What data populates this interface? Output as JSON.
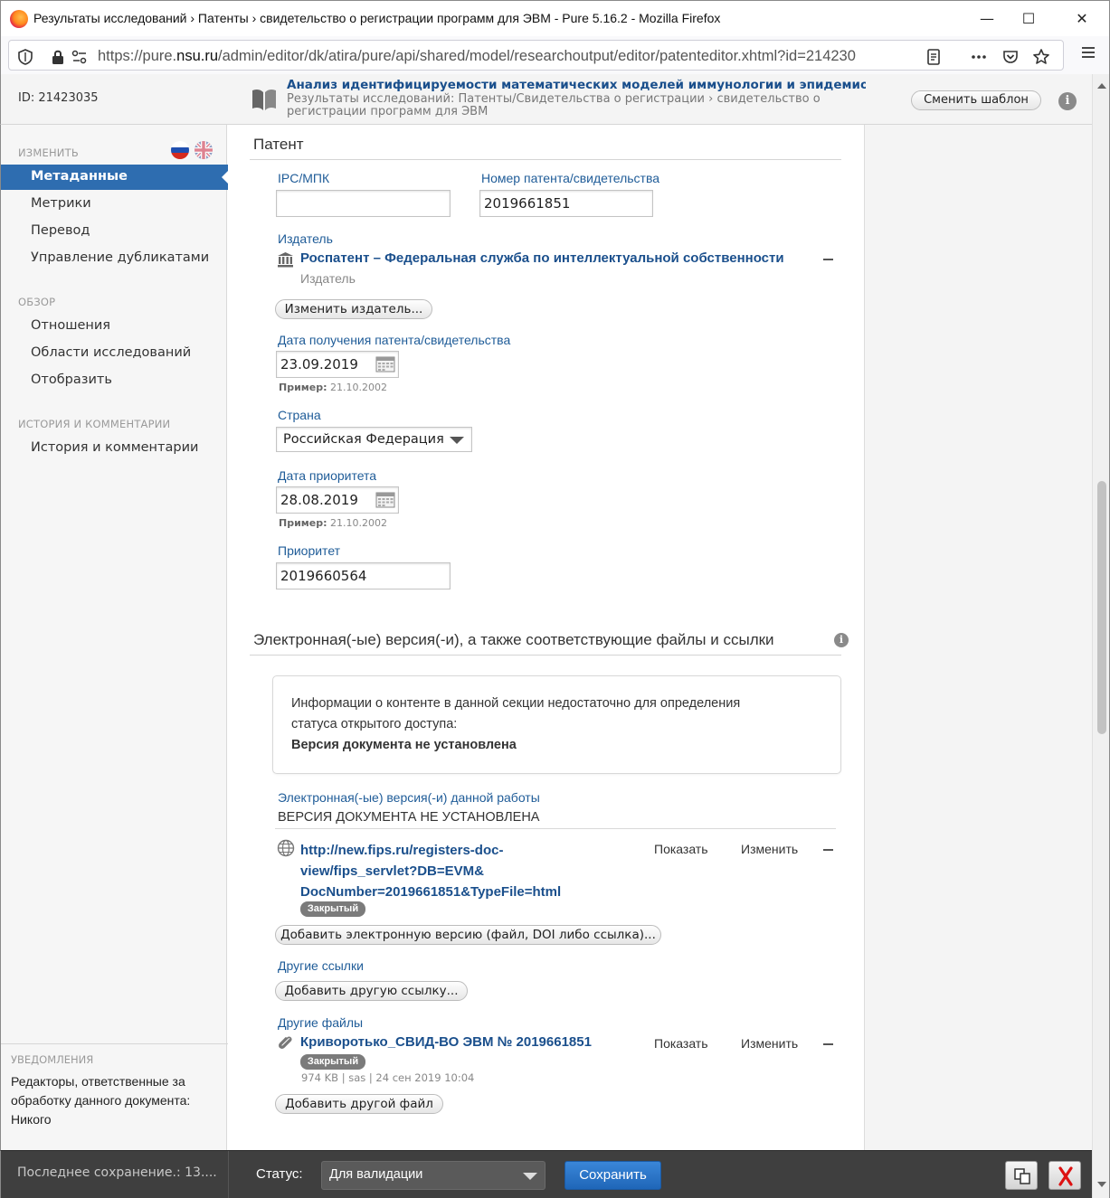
{
  "window": {
    "title": "Результаты исследований › Патенты › свидетельство о регистрации программ для ЭВМ - Pure 5.16.2 - Mozilla Firefox",
    "minimize": "—",
    "maximize": "☐",
    "close": "✕"
  },
  "urlbar": {
    "prefix": "https://pure.",
    "domain": "nsu.ru",
    "suffix": "/admin/editor/dk/atira/pure/api/shared/model/researchoutput/editor/patenteditor.xhtml?id=214230"
  },
  "header": {
    "id": "ID: 21423035",
    "title": "Анализ идентифицируемости математических моделей иммунологии и эпидемио",
    "breadcrumb": "Результаты исследований: Патенты/Свидетельства о регистрации › свидетельство о регистрации программ для ЭВМ",
    "change_template": "Сменить шаблон",
    "info": "i"
  },
  "sidebar": {
    "section_edit": "ИЗМЕНИТЬ",
    "edit_items": [
      "Метаданные",
      "Метрики",
      "Перевод",
      "Управление дубликатами"
    ],
    "section_overview": "ОБЗОР",
    "overview_items": [
      "Отношения",
      "Области исследований",
      "Отобразить"
    ],
    "section_history": "ИСТОРИЯ И КОММЕНТАРИИ",
    "history_items": [
      "История и комментарии"
    ],
    "notifications_title": "УВЕДОМЛЕНИЯ",
    "notifications_text": "Редакторы, ответственные за обработку данного документа: Никого"
  },
  "patent": {
    "section_title": "Патент",
    "ipc_label": "IPC/МПК",
    "ipc_value": "",
    "number_label": "Номер патента/свидетельства",
    "number_value": "2019661851",
    "publisher_label": "Издатель",
    "publisher_name": "Роспатент – Федеральная служба по интеллектуальной собственности",
    "publisher_type": "Издатель",
    "change_publisher": "Изменить издатель...",
    "date_received_label": "Дата получения патента/свидетельства",
    "date_received_value": "23.09.2019",
    "example_label": "Пример:",
    "example_value": "21.10.2002",
    "country_label": "Страна",
    "country_value": "Российская Федерация",
    "priority_date_label": "Дата приоритета",
    "priority_date_value": "28.08.2019",
    "priority_label": "Приоритет",
    "priority_value": "2019660564"
  },
  "electronic": {
    "section_title": "Электронная(-ые) версия(-и), а также соответствующие файлы и ссылки",
    "notice_line1": "Информации о контенте в данной секции недостаточно для определения",
    "notice_line2": "статуса открытого доступа:",
    "notice_bold": "Версия документа не установлена",
    "versions_label": "Электронная(-ые) версия(-и) данной работы",
    "version_status": "ВЕРСИЯ ДОКУМЕНТА НЕ УСТАНОВЛЕНА",
    "link_line1": "http://new.fips.ru/registers-doc-",
    "link_line2": "view/fips_servlet?DB=EVM&",
    "link_line3": "DocNumber=2019661851&TypeFile=html",
    "closed_badge": "Закрытый",
    "show": "Показать",
    "edit": "Изменить",
    "add_version": "Добавить электронную версию (файл, DOI либо ссылка)...",
    "other_links_label": "Другие ссылки",
    "add_link": "Добавить другую ссылку...",
    "other_files_label": "Другие файлы",
    "file_name": "Криворотько_СВИД-ВО ЭВМ № 2019661851",
    "file_meta": "974 KB | sas | 24 сен 2019 10:04",
    "add_file": "Добавить другой файл"
  },
  "bottombar": {
    "last_saved": "Последнее сохранение.: 13....",
    "status_label": "Статус:",
    "status_value": "Для валидации",
    "save": "Сохранить"
  },
  "colors": {
    "accent": "#2e6db0",
    "link": "#1a4f8c",
    "label": "#1f5c98",
    "bottombar": "#3f3f3f",
    "save": "#1f66b8"
  }
}
